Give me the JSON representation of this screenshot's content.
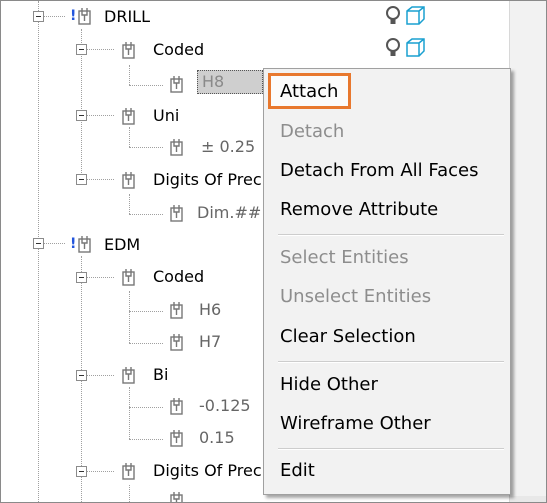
{
  "tree": {
    "drill": {
      "label": "DRILL",
      "mark": "!"
    },
    "drill_coded": {
      "label": "Coded",
      "value": "H8"
    },
    "drill_uni": {
      "label": "Uni",
      "value": "± 0.25"
    },
    "drill_digits": {
      "label": "Digits Of Prec",
      "value": "Dim.##"
    },
    "edm": {
      "label": "EDM",
      "mark": "!"
    },
    "edm_coded": {
      "label": "Coded",
      "values": [
        "H6",
        "H7"
      ]
    },
    "edm_bi": {
      "label": "Bi",
      "values": [
        "-0.125",
        "0.15"
      ]
    },
    "edm_digits": {
      "label": "Digits Of Prec"
    }
  },
  "context_menu": {
    "items": [
      {
        "label": "Attach",
        "enabled": true,
        "highlighted": true
      },
      {
        "label": "Detach",
        "enabled": false
      },
      {
        "label": "Detach From All Faces",
        "enabled": true
      },
      {
        "label": "Remove Attribute",
        "enabled": true
      },
      {
        "label": "Select Entities",
        "enabled": false
      },
      {
        "label": "Unselect Entities",
        "enabled": false
      },
      {
        "label": "Clear Selection",
        "enabled": true
      },
      {
        "label": "Hide Other",
        "enabled": true
      },
      {
        "label": "Wireframe Other",
        "enabled": true
      },
      {
        "label": "Edit",
        "enabled": true
      }
    ]
  },
  "colors": {
    "highlight_border": "#e8782e",
    "mark": "#2255dd",
    "cube_icon": "#1aa0d0",
    "bulb_icon": "#555555"
  },
  "icons": [
    "expand-collapse-icon",
    "attribute-icon",
    "value-icon",
    "lightbulb-icon",
    "cube-icon"
  ]
}
